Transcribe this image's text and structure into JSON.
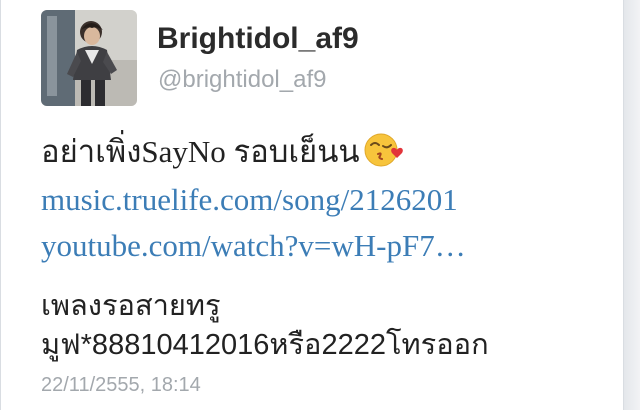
{
  "tweet": {
    "display_name": "Brightidol_af9",
    "handle": "@brightidol_af9",
    "avatar_icon": "profile-photo",
    "text_line1": "อย่าเพิ่งSayNo รอบเย็นน",
    "emoji_icon": "face-throwing-kiss-emoji",
    "links": [
      "music.truelife.com/song/2126201",
      "youtube.com/watch?v=wH-pF7…"
    ],
    "text_line2": "เพลงรอสายทรู",
    "text_line3": "มูฟ*88810412016หรือ2222โทรออก",
    "timestamp": "22/11/2555, 18:14",
    "link_color": "#3c7db6",
    "name_color": "#2b2b2b",
    "muted_color": "#a3a8ad"
  }
}
